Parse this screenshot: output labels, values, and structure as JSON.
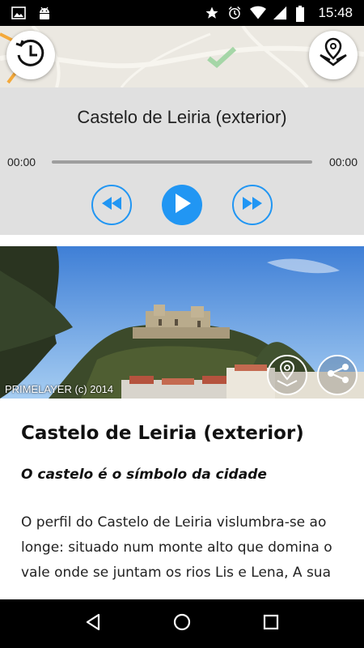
{
  "status_bar": {
    "time": "15:48",
    "left_icons": [
      "image-icon",
      "android-icon"
    ],
    "right_icons": [
      "star-icon",
      "alarm-icon",
      "wifi-icon",
      "signal-icon",
      "battery-icon"
    ]
  },
  "map_strip": {
    "left_button_icon": "clock-history-icon",
    "right_button_icon": "map-location-icon"
  },
  "player": {
    "title": "Castelo de Leiria (exterior)",
    "time_current": "00:00",
    "time_total": "00:00",
    "progress": 0,
    "accent_color": "#2196f3"
  },
  "photo": {
    "credit": "PRIMELAYER (c) 2014",
    "buttons": [
      "location-pin-icon",
      "share-icon"
    ]
  },
  "article": {
    "title": "Castelo de Leiria (exterior)",
    "subtitle": "O castelo é o símbolo da cidade",
    "body": "O perfil do Castelo de Leiria vislumbra-se ao longe: situado num monte alto que domina o vale onde se juntam os rios Lis e Lena, A sua"
  },
  "nav_bar": {
    "buttons": [
      "back-icon",
      "home-icon",
      "recents-icon"
    ]
  }
}
